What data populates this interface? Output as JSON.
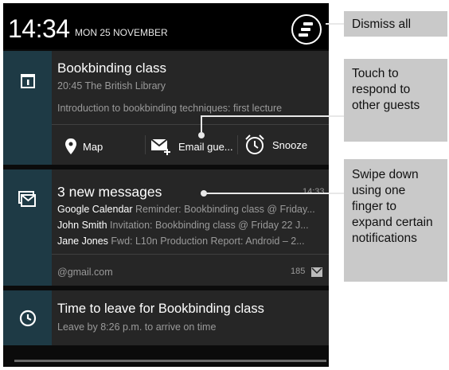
{
  "status_bar": {
    "time": "14:34",
    "date": "MON 25 NOVEMBER"
  },
  "notifications": [
    {
      "title": "Bookbinding class",
      "subtitle": "20:45 The British Library",
      "body": "Introduction to bookbinding techniques: first lecture",
      "icon": "calendar-icon",
      "actions": [
        {
          "label": "Map",
          "icon": "map-pin-icon"
        },
        {
          "label": "Email gue...",
          "icon": "email-add-icon"
        },
        {
          "label": "Snooze",
          "icon": "alarm-clock-icon"
        }
      ]
    },
    {
      "title": "3 new messages",
      "time": "14:33",
      "icon": "gmail-icon",
      "messages": [
        {
          "sender": "Google Calendar",
          "preview": "Reminder: Bookbinding class @ Friday..."
        },
        {
          "sender": "John Smith",
          "preview": "Invitation: Bookbinding class @ Friday 22 J..."
        },
        {
          "sender": "Jane Jones",
          "preview": "Fwd: L10n Production Report: Android – 2..."
        }
      ],
      "account": "@gmail.com",
      "count": "185"
    },
    {
      "title": "Time to leave for Bookbinding class",
      "subtitle": "Leave by 8:26 p.m. to arrive on time",
      "icon": "clock-icon"
    }
  ],
  "callouts": [
    {
      "text": "Dismiss all"
    },
    {
      "text": "Touch to respond to other guests"
    },
    {
      "text": "Swipe down using one finger to expand certain notifications"
    }
  ],
  "colors": {
    "shade_bg": "#0b0b0b",
    "card_bg": "#262626",
    "icon_bg": "#1e3a45",
    "callout_bg": "#c9c9c9"
  }
}
